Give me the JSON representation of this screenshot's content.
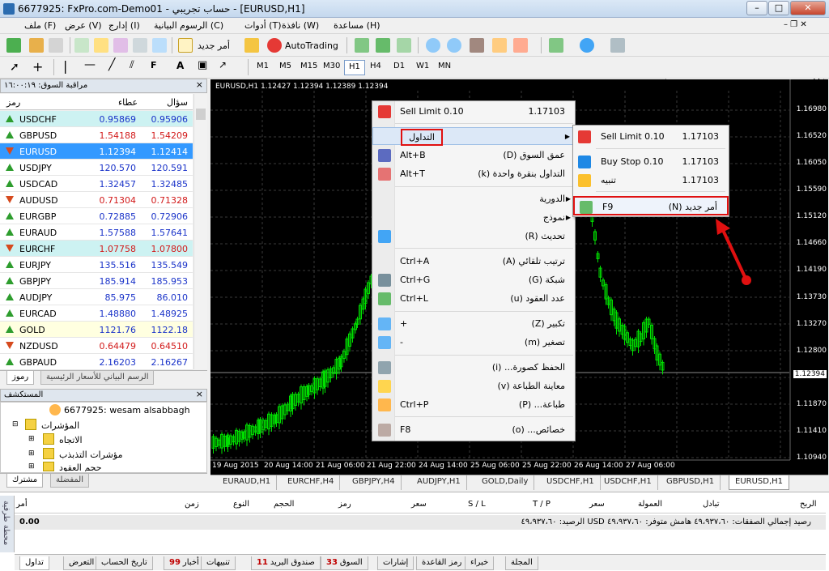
{
  "window": {
    "title": "6677925: FxPro.com-Demo01 - حساب تجريبي - [EURUSD,H1]"
  },
  "menu": [
    "ملف (F)",
    "عرض (V)",
    "إدارج (I)",
    "الرسوم البيانية (C)",
    "أدوات (T)",
    "نافذة (W)",
    "مساعدة (H)"
  ],
  "toolbar": {
    "new_order": "أمر جديد",
    "autotrading": "AutoTrading",
    "timeframes": [
      "M1",
      "M5",
      "M15",
      "M30",
      "H1",
      "H4",
      "D1",
      "W1",
      "MN"
    ],
    "active_tf": "H1"
  },
  "market_watch": {
    "title": "مراقبة السوق: ١٦:٠٠:١٩",
    "cols": {
      "symbol": "رمز",
      "bid": "عطاء",
      "ask": "سؤال"
    },
    "rows": [
      {
        "sym": "USDCHF",
        "bid": "0.95869",
        "ask": "0.95906",
        "dir": "up",
        "color": "blue",
        "bg": "#cdf2f2"
      },
      {
        "sym": "GBPUSD",
        "bid": "1.54188",
        "ask": "1.54209",
        "dir": "up",
        "color": "red",
        "bg": "#ffffff"
      },
      {
        "sym": "EURUSD",
        "bid": "1.12394",
        "ask": "1.12414",
        "dir": "dn",
        "color": "white",
        "bg": "#3399ff"
      },
      {
        "sym": "USDJPY",
        "bid": "120.570",
        "ask": "120.591",
        "dir": "up",
        "color": "blue",
        "bg": "#ffffff"
      },
      {
        "sym": "USDCAD",
        "bid": "1.32457",
        "ask": "1.32485",
        "dir": "up",
        "color": "blue",
        "bg": "#ffffff"
      },
      {
        "sym": "AUDUSD",
        "bid": "0.71304",
        "ask": "0.71328",
        "dir": "dn",
        "color": "red",
        "bg": "#ffffff"
      },
      {
        "sym": "EURGBP",
        "bid": "0.72885",
        "ask": "0.72906",
        "dir": "up",
        "color": "blue",
        "bg": "#ffffff"
      },
      {
        "sym": "EURAUD",
        "bid": "1.57588",
        "ask": "1.57641",
        "dir": "up",
        "color": "blue",
        "bg": "#ffffff"
      },
      {
        "sym": "EURCHF",
        "bid": "1.07758",
        "ask": "1.07800",
        "dir": "dn",
        "color": "red",
        "bg": "#cdf2f2"
      },
      {
        "sym": "EURJPY",
        "bid": "135.516",
        "ask": "135.549",
        "dir": "up",
        "color": "blue",
        "bg": "#ffffff"
      },
      {
        "sym": "GBPJPY",
        "bid": "185.914",
        "ask": "185.953",
        "dir": "up",
        "color": "blue",
        "bg": "#ffffff"
      },
      {
        "sym": "AUDJPY",
        "bid": "85.975",
        "ask": "86.010",
        "dir": "up",
        "color": "blue",
        "bg": "#ffffff"
      },
      {
        "sym": "EURCAD",
        "bid": "1.48880",
        "ask": "1.48925",
        "dir": "up",
        "color": "blue",
        "bg": "#ffffff"
      },
      {
        "sym": "GOLD",
        "bid": "1121.76",
        "ask": "1122.18",
        "dir": "up",
        "color": "blue",
        "bg": "#ffffe0"
      },
      {
        "sym": "NZDUSD",
        "bid": "0.64479",
        "ask": "0.64510",
        "dir": "dn",
        "color": "red",
        "bg": "#ffffff"
      },
      {
        "sym": "GBPAUD",
        "bid": "2.16203",
        "ask": "2.16267",
        "dir": "up",
        "color": "blue",
        "bg": "#ffffff"
      }
    ],
    "tabs": [
      "رموز",
      "الرسم البياني للأسعار الرئيسية"
    ]
  },
  "navigator": {
    "title": "المستكشف",
    "account": "6677925: wesam alsabbagh",
    "items": [
      "المؤشرات",
      "الاتجاه",
      "مؤشرات التذبذب",
      "حجم العقود"
    ],
    "tabs": [
      "مشترك",
      "المفضلة"
    ]
  },
  "chart": {
    "header": "EURUSD,H1  1.12427 1.12394 1.12389 1.12394",
    "price_labels": [
      "1.16980",
      "1.16520",
      "1.16050",
      "1.15590",
      "1.15120",
      "1.14660",
      "1.14190",
      "1.13730",
      "1.13270",
      "1.12800",
      "1.12394",
      "1.11870",
      "1.11410",
      "1.10940"
    ],
    "current_price": "1.12394",
    "time_labels": [
      "19 Aug 2015",
      "20 Aug 14:00",
      "21 Aug 06:00",
      "21 Aug 22:00",
      "24 Aug 14:00",
      "25 Aug 06:00",
      "25 Aug 22:00",
      "26 Aug 14:00",
      "27 Aug 06:00"
    ],
    "candle_color": "#00e000",
    "tabs": [
      "EURAUD,H1",
      "EURCHF,H4",
      "GBPJPY,H4",
      "AUDJPY,H1",
      "GOLD,Daily",
      "USDCHF,H1",
      "USDCHF,H1",
      "GBPUSD,H1",
      "EURUSD,H1"
    ],
    "active_tab": "EURUSD,H1"
  },
  "context_menu": {
    "items": [
      {
        "label": "Sell Limit 0.10",
        "right": "1.17103",
        "icon": "sell-icon"
      },
      {
        "label": "",
        "right": "التداول",
        "arrow": true,
        "highlight": true,
        "icon": ""
      },
      {
        "label": "Alt+B",
        "right": "عمق السوق (D)",
        "icon": "depth-icon"
      },
      {
        "label": "Alt+T",
        "right": "التداول بنقرة واحدة (k)",
        "icon": "oneclick-icon"
      },
      {
        "label": "",
        "right": "الدورية",
        "arrow": true,
        "icon": ""
      },
      {
        "label": "",
        "right": "نموذج",
        "arrow": true,
        "icon": ""
      },
      {
        "label": "",
        "right": "تحديث (R)",
        "icon": "refresh-icon"
      },
      {
        "label": "Ctrl+A",
        "right": "ترتيب تلقائي (A)",
        "icon": ""
      },
      {
        "label": "Ctrl+G",
        "right": "شبكة (G)",
        "icon": "grid-icon"
      },
      {
        "label": "Ctrl+L",
        "right": "عدد العقود (u)",
        "icon": "volume-icon"
      },
      {
        "label": "+",
        "right": "تكبير (Z)",
        "icon": "zoomin-icon"
      },
      {
        "label": "-",
        "right": "تصغير (m)",
        "icon": "zoomout-icon"
      },
      {
        "label": "",
        "right": "الحفظ كصورة... (i)",
        "icon": "saveimage-icon"
      },
      {
        "label": "",
        "right": "معاينة الطباعة (v)",
        "icon": "printpreview-icon"
      },
      {
        "label": "Ctrl+P",
        "right": "طباعة... (P)",
        "icon": "print-icon"
      },
      {
        "label": "F8",
        "right": "خصائص... (o)",
        "icon": "properties-icon"
      }
    ]
  },
  "submenu": {
    "items": [
      {
        "label": "Sell Limit 0.10",
        "right": "1.17103",
        "icon": "sell-icon"
      },
      {
        "label": "Buy Stop 0.10",
        "right": "1.17103",
        "icon": "buy-icon"
      },
      {
        "label": "تنبيه",
        "right": "1.17103",
        "icon": "bell-icon"
      },
      {
        "label": "F9",
        "right": "أمر جديد (N)",
        "icon": "neworder-icon",
        "highlight": true
      }
    ]
  },
  "terminal": {
    "side_label": "محطة طرفية",
    "cols": [
      "أمر",
      "زمن",
      "النوع",
      "الحجم",
      "رمز",
      "سعر",
      "S / L",
      "T / P",
      "سعر",
      "العمولة",
      "تبادل",
      "الربح"
    ],
    "balance": "رصيد إجمالي الصفقات: ٤٩،٩٣٧،٦٠  هامش متوفر: ٤٩،٩٣٧،٦٠  USD الرصيد: ٤٩،٩٣٧،٦٠",
    "profit": "0.00",
    "tabs": [
      {
        "label": "تداول",
        "badge": ""
      },
      {
        "label": "التعرض",
        "badge": ""
      },
      {
        "label": "تاريخ الحساب",
        "badge": ""
      },
      {
        "label": "أخبار",
        "badge": "99"
      },
      {
        "label": "تنبيهات",
        "badge": ""
      },
      {
        "label": "صندوق البريد",
        "badge": "11"
      },
      {
        "label": "السوق",
        "badge": "33"
      },
      {
        "label": "إشارات",
        "badge": ""
      },
      {
        "label": "رمز القاعدة",
        "badge": ""
      },
      {
        "label": "خبراء",
        "badge": ""
      },
      {
        "label": "المجلة",
        "badge": ""
      }
    ]
  }
}
